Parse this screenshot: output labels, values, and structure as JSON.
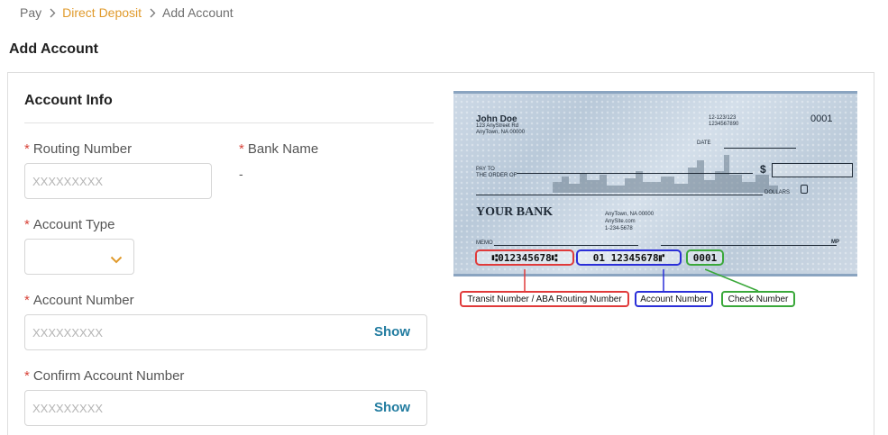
{
  "breadcrumb": {
    "items": [
      "Pay",
      "Direct Deposit",
      "Add Account"
    ]
  },
  "page": {
    "title": "Add Account"
  },
  "account_info": {
    "title": "Account Info",
    "routing_number": {
      "label": "Routing Number",
      "required_marker": "*",
      "placeholder": "XXXXXXXXX",
      "value": ""
    },
    "bank_name": {
      "label": "Bank Name",
      "required_marker": "*",
      "value": "-"
    },
    "account_type": {
      "label": "Account Type",
      "required_marker": "*",
      "value": ""
    },
    "account_number": {
      "label": "Account Number",
      "required_marker": "*",
      "placeholder": "XXXXXXXXX",
      "value": "",
      "show_label": "Show"
    },
    "confirm_account_number": {
      "label": "Confirm Account Number",
      "required_marker": "*",
      "placeholder": "XXXXXXXXX",
      "value": "",
      "show_label": "Show"
    }
  },
  "check_illustration": {
    "name": "John Doe",
    "address_line1": "123 AnyStreet Rd",
    "address_line2": "AnyTown, NA 00000",
    "fraction_code": "12-123/123",
    "fraction_code2": "1234567890",
    "check_number": "0001",
    "date_label": "DATE",
    "pay_to_line1": "PAY TO",
    "pay_to_line2": "THE ORDER OF",
    "dollar_sign": "$",
    "dollars_label": "DOLLARS",
    "bank_name": "YOUR BANK",
    "bank_address": "AnyTown, NA 00000",
    "bank_site": "AnySite.com",
    "bank_phone": "1-234-5678",
    "memo_label": "MEMO",
    "mp_label": "MP",
    "micr_routing": "⑆012345678⑆",
    "micr_account": "01 12345678⑈",
    "micr_check": "0001",
    "callouts": {
      "routing": "Transit Number / ABA Routing Number",
      "account": "Account Number",
      "check": "Check Number"
    }
  },
  "colors": {
    "accent": "#e09a2b",
    "link": "#227ca0",
    "required": "#d8443a",
    "routing_outline": "#e03a3a",
    "account_outline": "#2b2fd8",
    "check_outline": "#3aa83a"
  },
  "icons": {
    "breadcrumb_separator": "chevron-right-icon",
    "select_caret": "chevron-down-icon"
  }
}
